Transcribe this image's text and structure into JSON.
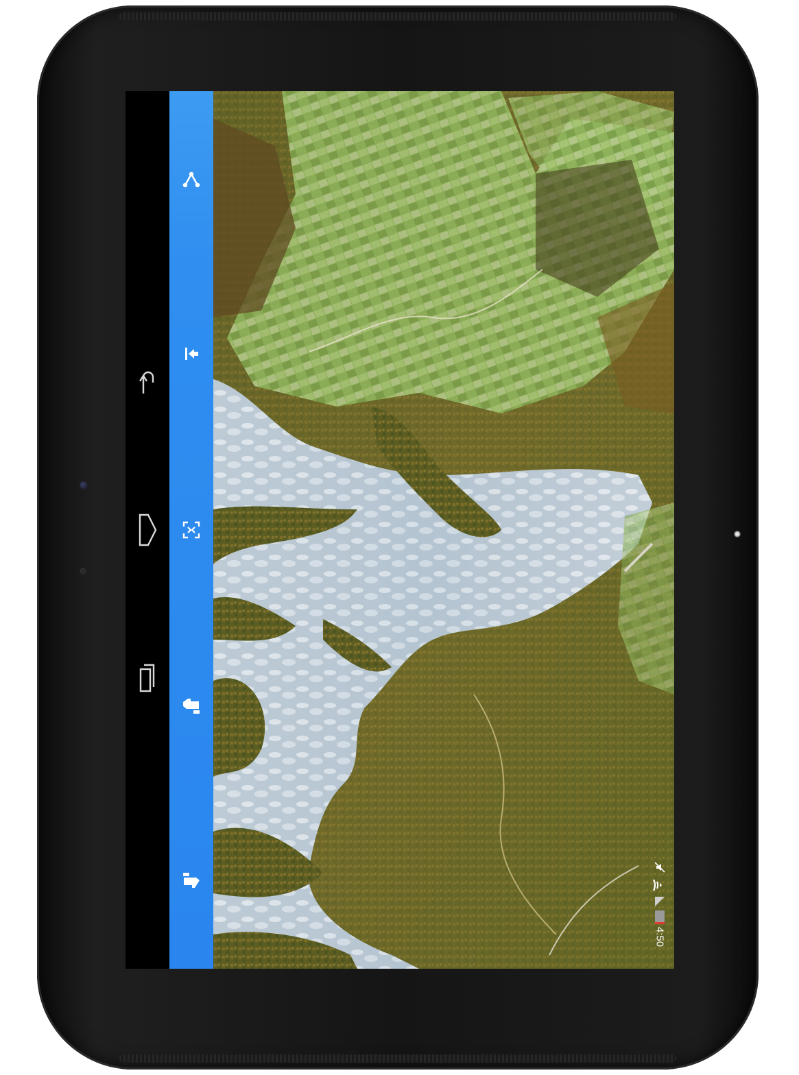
{
  "device": {
    "model": "tablet",
    "orientation": "landscape-rotated"
  },
  "navigation_bar": {
    "buttons": [
      {
        "name": "back",
        "icon": "back-arrow-icon"
      },
      {
        "name": "home",
        "icon": "home-icon"
      },
      {
        "name": "recents",
        "icon": "recents-icon"
      }
    ]
  },
  "toolbar": {
    "color": "#2a86ee",
    "tools": [
      {
        "id": "share",
        "icon": "share-icon"
      },
      {
        "id": "previous",
        "icon": "skip-previous-icon"
      },
      {
        "id": "fit",
        "icon": "fit-screen-icon"
      },
      {
        "id": "like",
        "icon": "thumbs-up-icon"
      },
      {
        "id": "dislike",
        "icon": "thumbs-down-icon"
      }
    ]
  },
  "image": {
    "description_icon": "aerial-photo",
    "colors": {
      "water": "#9fb0c2",
      "forest": "#6f7a2a",
      "field": "#9cc06a"
    }
  },
  "status_bar": {
    "time": "4:50",
    "icons": [
      "mute-icon",
      "wifi-icon",
      "signal-icon",
      "battery-icon"
    ]
  }
}
